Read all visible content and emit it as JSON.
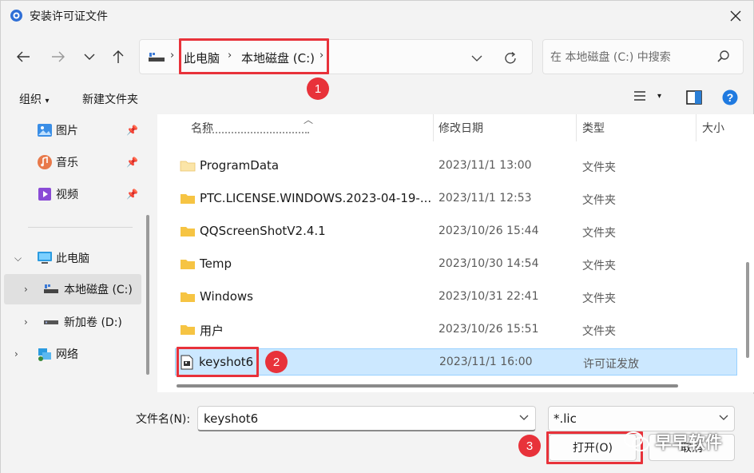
{
  "window": {
    "title": "安装许可证文件"
  },
  "address": {
    "crumbs": [
      "此电脑",
      "本地磁盘 (C:)"
    ],
    "search_placeholder": "在 本地磁盘 (C:) 中搜索"
  },
  "toolbar": {
    "organize": "组织",
    "new_folder": "新建文件夹"
  },
  "sidebar": {
    "items": [
      {
        "label": "图片",
        "icon": "pictures-icon"
      },
      {
        "label": "音乐",
        "icon": "music-icon"
      },
      {
        "label": "视频",
        "icon": "videos-icon"
      },
      {
        "label": "此电脑",
        "icon": "this-pc-icon"
      },
      {
        "label": "本地磁盘 (C:)",
        "icon": "drive-icon"
      },
      {
        "label": "新加卷 (D:)",
        "icon": "drive-icon"
      },
      {
        "label": "网络",
        "icon": "network-icon"
      }
    ]
  },
  "columns": {
    "name": "名称",
    "modified": "修改日期",
    "type": "类型",
    "size": "大小"
  },
  "files": [
    {
      "name": "ProgramData",
      "date": "2023/11/1 13:00",
      "type": "文件夹",
      "kind": "folder"
    },
    {
      "name": "PTC.LICENSE.WINDOWS.2023-04-19-...",
      "date": "2023/11/1 12:53",
      "type": "文件夹",
      "kind": "folder"
    },
    {
      "name": "QQScreenShotV2.4.1",
      "date": "2023/10/26 15:44",
      "type": "文件夹",
      "kind": "folder"
    },
    {
      "name": "Temp",
      "date": "2023/10/30 14:54",
      "type": "文件夹",
      "kind": "folder"
    },
    {
      "name": "Windows",
      "date": "2023/10/31 22:41",
      "type": "文件夹",
      "kind": "folder"
    },
    {
      "name": "用户",
      "date": "2023/10/26 15:51",
      "type": "文件夹",
      "kind": "folder"
    },
    {
      "name": "keyshot6",
      "date": "2023/11/1 16:00",
      "type": "许可证发放",
      "kind": "file"
    }
  ],
  "bottom": {
    "filename_label": "文件名(N):",
    "filename_value": "keyshot6",
    "filter_value": "*.lic",
    "open_label": "打开(O)",
    "cancel_label": "取消"
  },
  "annotations": {
    "step1": "1",
    "step2": "2",
    "step3": "3"
  },
  "watermark": "早早软件",
  "colors": {
    "highlight": "#e8323a",
    "selection": "#cce8ff",
    "folder": "#f6c443"
  }
}
